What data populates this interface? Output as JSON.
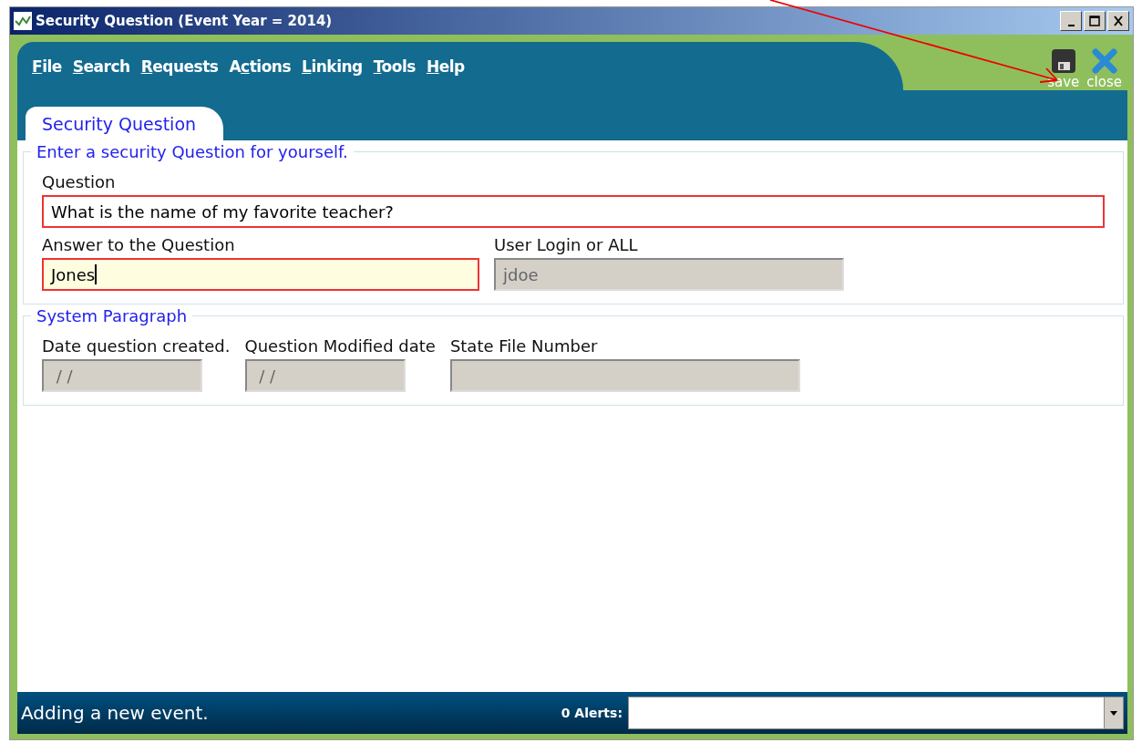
{
  "window": {
    "title": "Security Question (Event Year = 2014)"
  },
  "menu": [
    {
      "key": "F",
      "post": "ile"
    },
    {
      "key": "S",
      "post": "earch"
    },
    {
      "key": "R",
      "post": "equests"
    },
    {
      "pre": "A",
      "key": "c",
      "post": "tions"
    },
    {
      "key": "L",
      "post": "inking"
    },
    {
      "key": "T",
      "post": "ools"
    },
    {
      "key": "H",
      "post": "elp"
    }
  ],
  "toolbar": [
    {
      "kind": "save",
      "label": "save"
    },
    {
      "kind": "close",
      "label": "close"
    }
  ],
  "tabs": [
    {
      "label": "Security Question",
      "selected": true
    }
  ],
  "sections": [
    {
      "title": "Enter a security Question for yourself.",
      "rows": [
        [
          {
            "label": "Question",
            "value": "What is the name of my favorite teacher?",
            "kind": "full",
            "invalid": true,
            "disabled": false,
            "focused": false
          }
        ],
        [
          {
            "label": "Answer to the Question",
            "value": "Jones",
            "kind": "wide",
            "invalid": true,
            "disabled": false,
            "focused": true
          },
          {
            "label": "User Login or ALL",
            "value": "jdoe",
            "kind": "mid",
            "invalid": false,
            "disabled": true,
            "focused": false
          }
        ]
      ]
    },
    {
      "title": "System Paragraph",
      "rows": [
        [
          {
            "label": "Date question created.",
            "value": " / /",
            "kind": "small",
            "invalid": false,
            "disabled": true,
            "focused": false
          },
          {
            "label": "Question Modified date",
            "value": " / /",
            "kind": "small",
            "invalid": false,
            "disabled": true,
            "focused": false
          },
          {
            "label": "State File Number",
            "kind": "mid",
            "invalid": false,
            "disabled": true,
            "focused": false
          }
        ]
      ]
    }
  ],
  "status_bar": {
    "message": "Adding a new event.",
    "alerts_label": "0 Alerts:"
  }
}
